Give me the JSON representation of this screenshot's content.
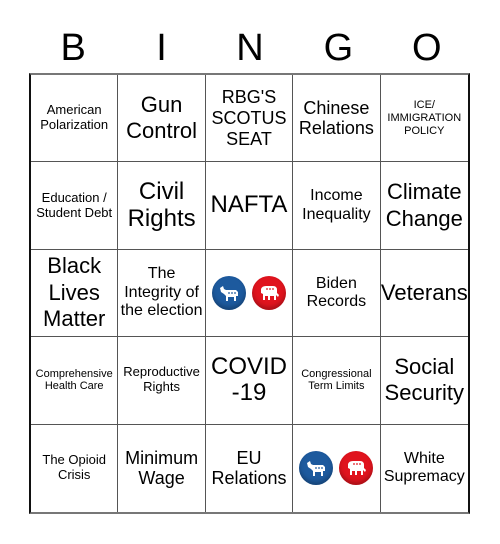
{
  "header": {
    "letters": [
      "B",
      "I",
      "N",
      "G",
      "O"
    ]
  },
  "colors": {
    "democrat": "#1d5a9e",
    "republican": "#e0141e"
  },
  "cells": [
    {
      "text": "American Polarization",
      "size": "s-sm"
    },
    {
      "text": "Gun Control",
      "size": "s-xl"
    },
    {
      "text": "RBG'S SCOTUS SEAT",
      "size": "s-lg"
    },
    {
      "text": "Chinese Relations",
      "size": "s-lg"
    },
    {
      "text": "ICE/ IMMIGRATION POLICY",
      "size": "s-xs"
    },
    {
      "text": "Education / Student Debt",
      "size": "s-sm"
    },
    {
      "text": "Civil Rights",
      "size": "s-xxl"
    },
    {
      "text": "NAFTA",
      "size": "s-xxl"
    },
    {
      "text": "Income Inequality",
      "size": "s-md"
    },
    {
      "text": "Climate Change",
      "size": "s-xl"
    },
    {
      "text": "Black Lives Matter",
      "size": "s-xl"
    },
    {
      "text": "The Integrity of the election",
      "size": "s-md"
    },
    {
      "free": true,
      "icons": [
        "democrat-donkey-icon",
        "republican-elephant-icon"
      ]
    },
    {
      "text": "Biden Records",
      "size": "s-md"
    },
    {
      "text": "Veterans",
      "size": "s-xl"
    },
    {
      "text": "Comprehensive Health Care",
      "size": "s-xs"
    },
    {
      "text": "Reproductive Rights",
      "size": "s-sm"
    },
    {
      "text": "COVID -19",
      "size": "s-xxl"
    },
    {
      "text": "Congressional Term Limits",
      "size": "s-xs"
    },
    {
      "text": "Social Security",
      "size": "s-xl"
    },
    {
      "text": "The Opioid Crisis",
      "size": "s-sm"
    },
    {
      "text": "Minimum Wage",
      "size": "s-lg"
    },
    {
      "text": "EU Relations",
      "size": "s-lg"
    },
    {
      "free": true,
      "icons": [
        "democrat-donkey-icon",
        "republican-elephant-icon"
      ]
    },
    {
      "text": "White Supremacy",
      "size": "s-md"
    }
  ]
}
